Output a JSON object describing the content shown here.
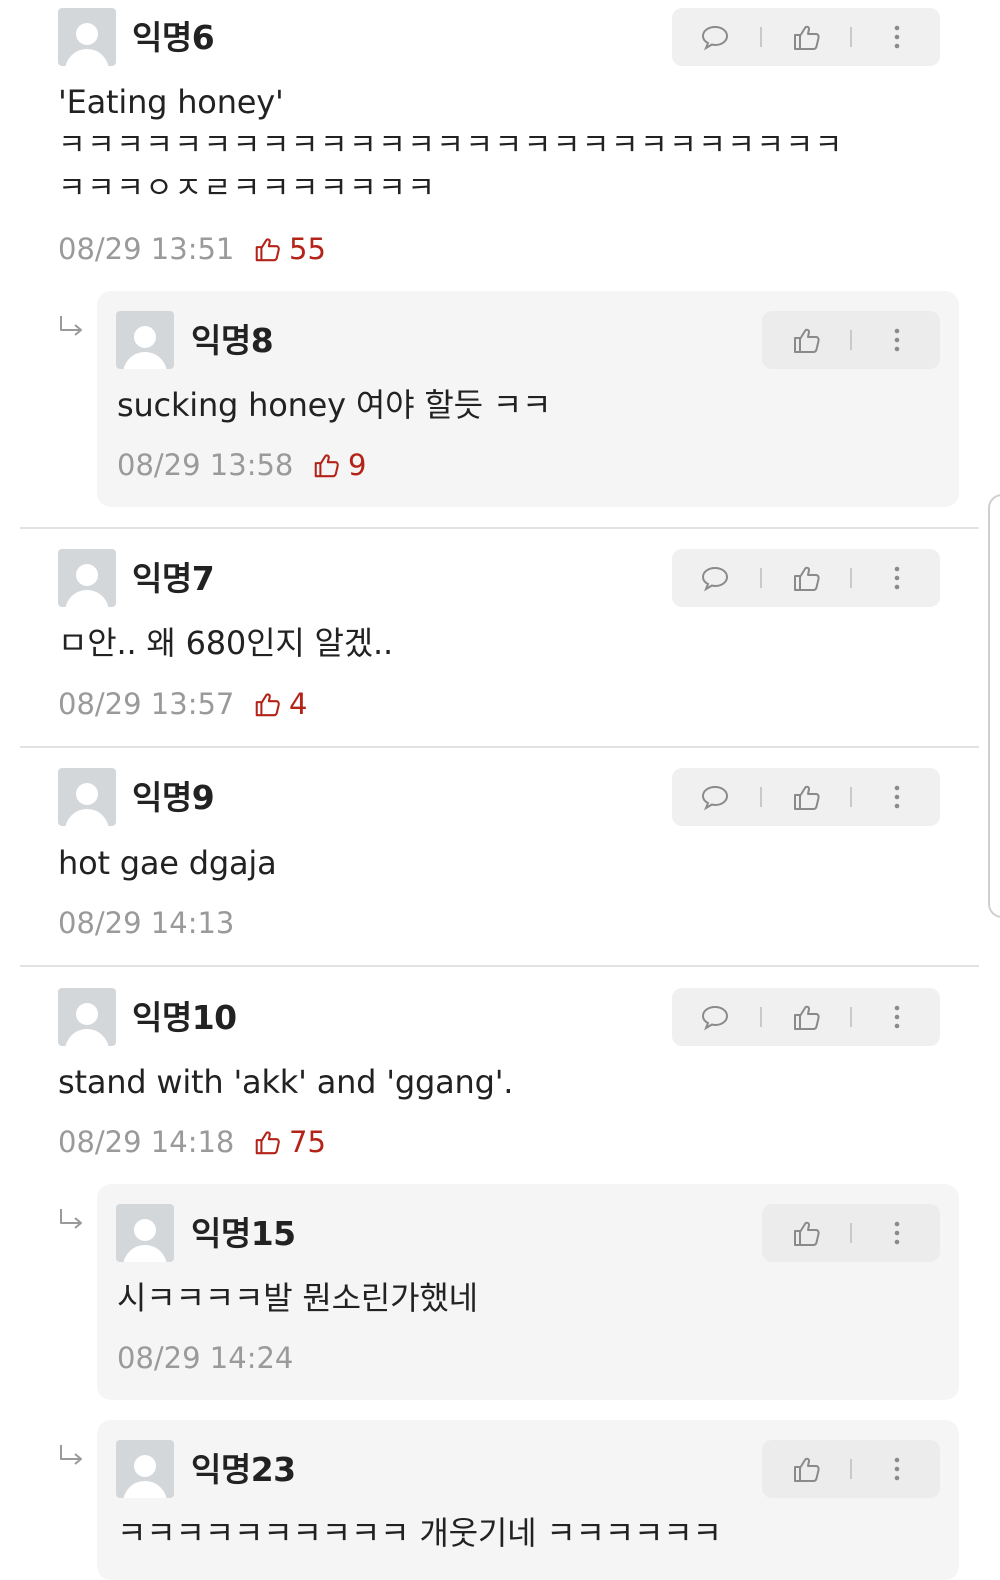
{
  "comments": [
    {
      "author": "익명6",
      "text_lines": [
        "'Eating honey'",
        "ㅋㅋㅋㅋㅋㅋㅋㅋㅋㅋㅋㅋㅋㅋㅋㅋㅋㅋㅋㅋㅋㅋㅋㅋㅋㅋㅋ",
        "ㅋㅋㅋㅇㅈㄹㅋㅋㅋㅋㅋㅋㅋ"
      ],
      "time": "08/29 13:51",
      "likes": "55",
      "replies": [
        {
          "author": "익명8",
          "text": "sucking honey 여야 할듯 ㅋㅋ",
          "time": "08/29 13:58",
          "likes": "9"
        }
      ]
    },
    {
      "author": "익명7",
      "text": "ㅁ안.. 왜 680인지 알겠..",
      "time": "08/29 13:57",
      "likes": "4"
    },
    {
      "author": "익명9",
      "text": "hot gae dgaja",
      "time": "08/29 14:13"
    },
    {
      "author": "익명10",
      "text": "stand with 'akk' and 'ggang'.",
      "time": "08/29 14:18",
      "likes": "75",
      "replies": [
        {
          "author": "익명15",
          "text": "시ㅋㅋㅋㅋ발 뭔소린가했네",
          "time": "08/29 14:24"
        },
        {
          "author": "익명23",
          "text": "ㅋㅋㅋㅋㅋㅋㅋㅋㅋㅋ 개웃기네 ㅋㅋㅋㅋㅋㅋ"
        }
      ]
    }
  ],
  "icons": {
    "reply": "speech-bubble-icon",
    "like": "thumbs-up-icon",
    "more": "kebab-menu-icon",
    "reply_indicator": "reply-arrow-icon",
    "avatar": "default-avatar"
  },
  "colors": {
    "like_count": "#b32318",
    "meta": "#9a9a9a",
    "action_bg": "#f0f0f0",
    "reply_bg": "#f5f5f5"
  }
}
